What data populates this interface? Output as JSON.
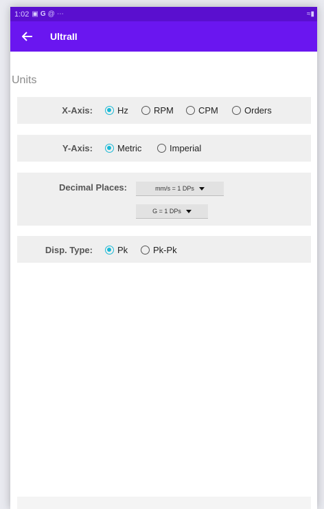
{
  "statusbar": {
    "time": "1:02",
    "icons": [
      "image-icon",
      "google-icon",
      "at-icon",
      "more-icon"
    ],
    "right_icons": [
      "wifi-icon",
      "battery-icon"
    ]
  },
  "appbar": {
    "title": "UltraII",
    "back_icon": "arrow-back-icon"
  },
  "section_title": "Units",
  "x_axis": {
    "label": "X-Axis:",
    "options": [
      "Hz",
      "RPM",
      "CPM",
      "Orders"
    ],
    "selected": "Hz"
  },
  "y_axis": {
    "label": "Y-Axis:",
    "options": [
      "Metric",
      "Imperial"
    ],
    "selected": "Metric"
  },
  "decimal_places": {
    "label": "Decimal Places:",
    "velocity": "mm/s = 1 DPs",
    "acceleration": "G = 1 DPs"
  },
  "disp_type": {
    "label": "Disp. Type:",
    "options": [
      "Pk",
      "Pk-Pk"
    ],
    "selected": "Pk"
  },
  "colors": {
    "appbar": "#6a16f0",
    "statusbar": "#5a0fcf",
    "radio_selected": "#18b9d6",
    "row_bg": "#efefef"
  }
}
